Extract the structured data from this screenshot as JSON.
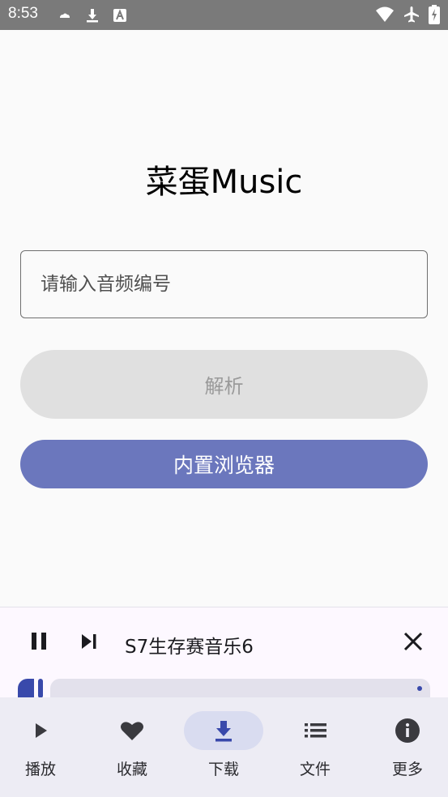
{
  "status_bar": {
    "time": "8:53"
  },
  "app": {
    "title": "菜蛋Music"
  },
  "form": {
    "input_placeholder": "请输入音频编号",
    "parse_label": "解析",
    "browser_label": "内置浏览器"
  },
  "player": {
    "track_name": "S7生存赛音乐6",
    "progress": 0.03
  },
  "nav": {
    "items": [
      {
        "label": "播放",
        "icon": "play-icon"
      },
      {
        "label": "收藏",
        "icon": "heart-icon"
      },
      {
        "label": "下载",
        "icon": "download-icon",
        "selected": true
      },
      {
        "label": "文件",
        "icon": "list-icon"
      },
      {
        "label": "更多",
        "icon": "info-icon"
      }
    ]
  },
  "colors": {
    "accent": "#6b77bd",
    "player_accent": "#3949ab",
    "status_bar": "#7a7a7a",
    "nav_bg": "#edecf4",
    "nav_selected_pill": "#d9dcf0"
  }
}
